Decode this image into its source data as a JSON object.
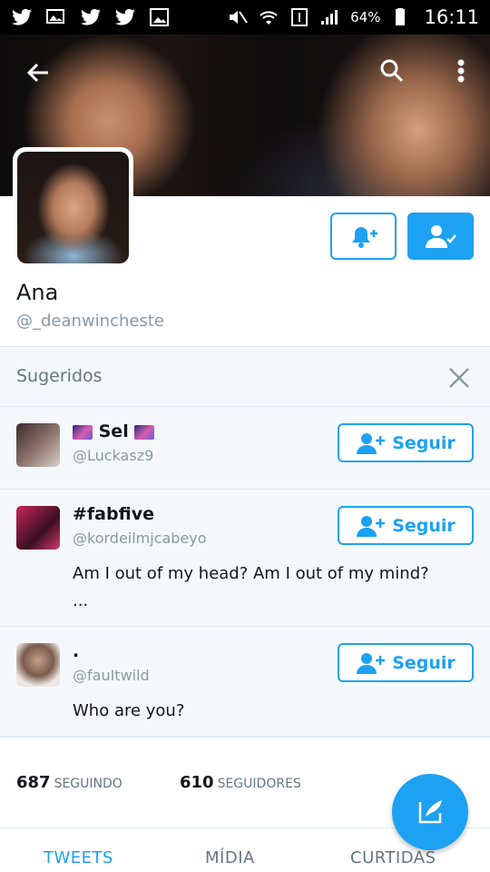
{
  "status_bar": {
    "battery": "64%",
    "time": "16:11",
    "icons": [
      "twitter-icon",
      "image-icon",
      "twitter-icon",
      "twitter-icon",
      "gallery-icon",
      "mute-icon",
      "wifi-icon",
      "sim-1-icon",
      "signal-icon",
      "battery-icon"
    ]
  },
  "profile": {
    "name": "Ana",
    "handle": "@_deanwincheste"
  },
  "suggestions": {
    "title": "Sugeridos",
    "items": [
      {
        "name": "Sel",
        "handle": "@Luckasz9",
        "bio": "",
        "button": "Seguir"
      },
      {
        "name": "#fabfive",
        "handle": "@kordeilmjcabeyo",
        "bio": "Am I out of my head? Am I out of my mind?",
        "bio_more": "...",
        "button": "Seguir"
      },
      {
        "name": ".",
        "handle": "@fauItwild",
        "bio": "Who are you?",
        "button": "Seguir"
      }
    ]
  },
  "stats": {
    "following_count": "687",
    "following_label": "SEGUINDO",
    "followers_count": "610",
    "followers_label": "SEGUIDORES"
  },
  "tabs": [
    {
      "label": "TWEETS",
      "active": true
    },
    {
      "label": "MÍDIA",
      "active": false
    },
    {
      "label": "CURTIDAS",
      "active": false
    }
  ],
  "colors": {
    "accent": "#1da1f2",
    "text": "#14171a",
    "muted": "#8899a6",
    "panel": "#f5f8fa"
  }
}
